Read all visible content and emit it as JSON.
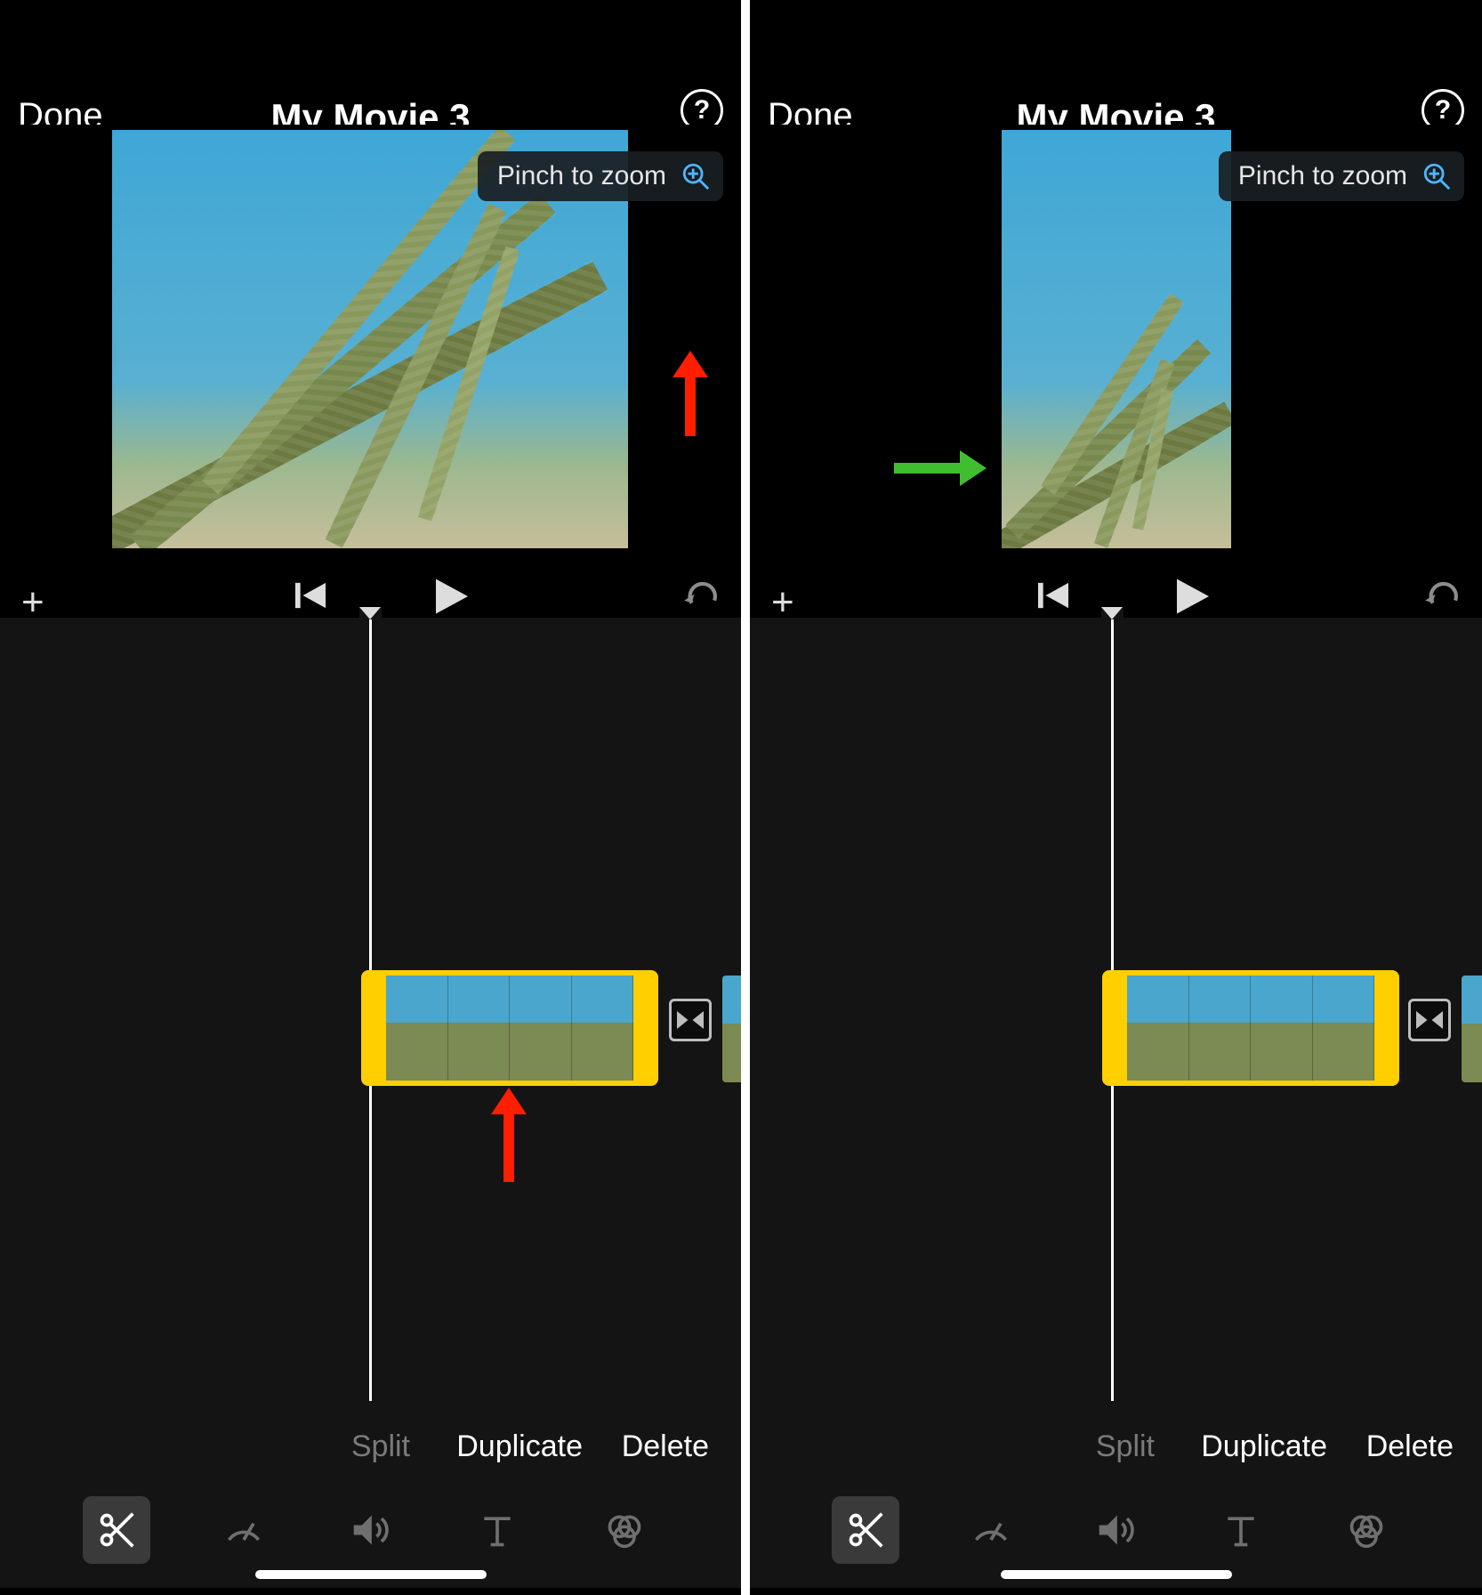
{
  "left": {
    "done": "Done",
    "title": "My Movie 3",
    "hint": "Pinch to zoom",
    "edit": {
      "split": "Split",
      "duplicate": "Duplicate",
      "delete": "Delete"
    }
  },
  "right": {
    "done": "Done",
    "title": "My Movie 3",
    "hint": "Pinch to zoom",
    "edit": {
      "split": "Split",
      "duplicate": "Duplicate",
      "delete": "Delete"
    }
  },
  "icons": {
    "help": "help-icon",
    "zoom": "zoom-in-icon",
    "add": "plus-icon",
    "skip": "skip-back-icon",
    "play": "play-icon",
    "undo": "undo-icon",
    "transition": "transition-icon",
    "cut": "scissors-icon",
    "speed": "speedometer-icon",
    "volume": "volume-icon",
    "text": "text-icon",
    "filter": "filters-icon"
  },
  "annotations": {
    "left_red_arrow_preview": "points at pinch-to-zoom button",
    "left_red_arrow_clip": "points at selected clip",
    "right_green_arrow": "points at preview left edge"
  }
}
